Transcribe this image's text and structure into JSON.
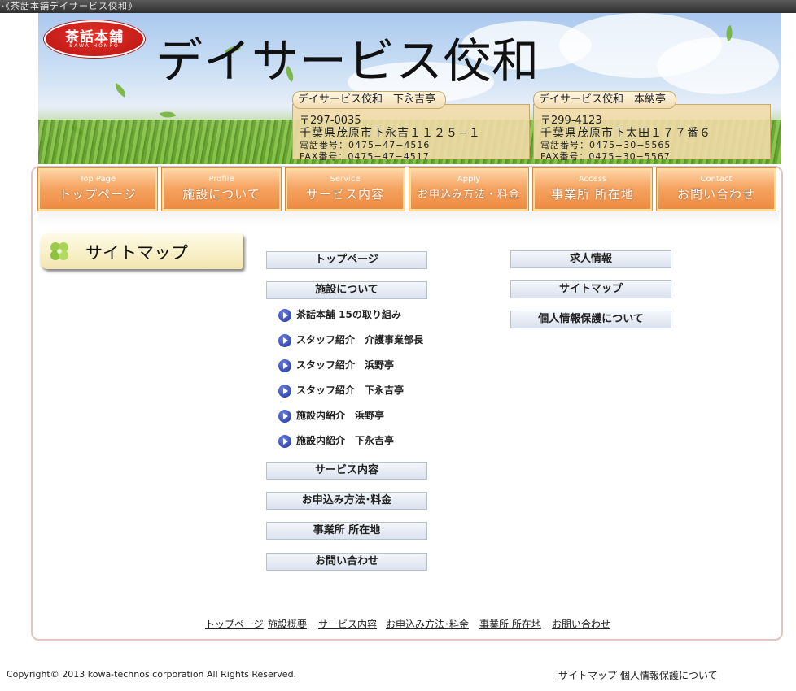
{
  "topbar": {
    "title": "·《茶話本舗デイサービス佼和》"
  },
  "header": {
    "logo_main": "茶話本舗",
    "logo_sub": "SAWA HONPO",
    "title": "デイサービス佼和",
    "facilities": [
      {
        "name": "デイサービス佼和　下永吉亭",
        "postal": "〒297-0035",
        "address": "千葉県茂原市下永吉１１２５−１",
        "phone": "電話番号：0475−47−4516",
        "fax": "FAX番号：0475−47−4517"
      },
      {
        "name": "デイサービス佼和　本納亭",
        "postal": "〒299-4123",
        "address": "千葉県茂原市下太田１７７番６",
        "phone": "電話番号：0475−30−5565",
        "fax": "FAX番号：0475−30−5567"
      }
    ]
  },
  "nav": [
    {
      "en": "Top Page",
      "ja": "トップページ"
    },
    {
      "en": "Profile",
      "ja": "施設について"
    },
    {
      "en": "Service",
      "ja": "サービス内容"
    },
    {
      "en": "Apply",
      "ja": "お申込み方法・料金"
    },
    {
      "en": "Access",
      "ja": "事業所 所在地"
    },
    {
      "en": "Contact",
      "ja": "お問い合わせ"
    }
  ],
  "sitemap": {
    "heading": "サイトマップ",
    "col1": {
      "top": "トップページ",
      "about": "施設について",
      "sub": [
        "茶話本舗 15の取り組み",
        "スタッフ紹介　介護事業部長",
        "スタッフ紹介　浜野亭",
        "スタッフ紹介　下永吉亭",
        "施設内紹介　浜野亭",
        "施設内紹介　下永吉亭"
      ],
      "service": "サービス内容",
      "apply": "お申込み方法･料金",
      "access": "事業所 所在地",
      "contact": "お問い合わせ"
    },
    "col2": {
      "recruit": "求人情報",
      "sitemap": "サイトマップ",
      "privacy": "個人情報保護について"
    }
  },
  "footer_links": [
    "トップページ",
    "施設概要",
    "サービス内容",
    "お申込み方法･料金",
    "事業所 所在地",
    "お問い合わせ"
  ],
  "bottom": {
    "copyright": "Copyright© 2013 kowa-technos corporation All Rights Reserved.",
    "links": [
      "サイトマップ",
      "個人情報保護について"
    ]
  }
}
